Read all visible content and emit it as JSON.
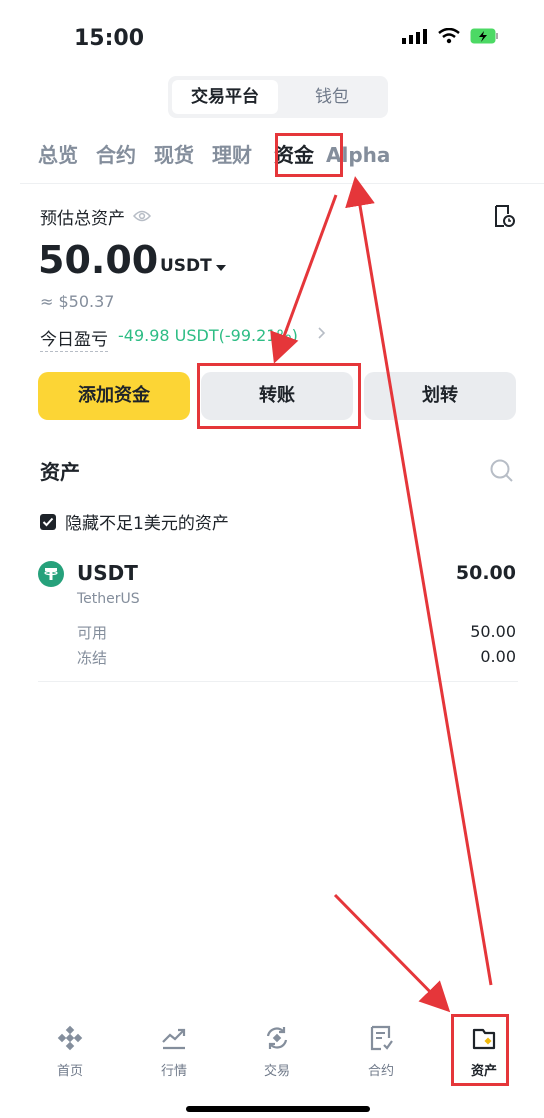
{
  "status_bar": {
    "time": "15:00"
  },
  "segmented": {
    "active": "交易平台",
    "inactive": "钱包"
  },
  "tabs": [
    "总览",
    "合约",
    "现货",
    "理财",
    "资金",
    "Alpha"
  ],
  "estimate": {
    "label": "预估总资产",
    "amount": "50.00",
    "currency": "USDT",
    "usd_approx": "≈ $50.37",
    "pnl_label": "今日盈亏",
    "pnl_value": "-49.98 USDT(-99.21%)"
  },
  "buttons": {
    "add": "添加资金",
    "transfer": "转账",
    "move": "划转"
  },
  "assets": {
    "title": "资产",
    "hide_small": "隐藏不足1美元的资产",
    "items": [
      {
        "symbol": "USDT",
        "name": "TetherUS",
        "total": "50.00",
        "available_label": "可用",
        "available": "50.00",
        "frozen_label": "冻结",
        "frozen": "0.00"
      }
    ]
  },
  "bottom_nav": [
    {
      "label": "首页",
      "icon": "home-icon"
    },
    {
      "label": "行情",
      "icon": "markets-icon"
    },
    {
      "label": "交易",
      "icon": "trade-icon"
    },
    {
      "label": "合约",
      "icon": "futures-icon"
    },
    {
      "label": "资产",
      "icon": "wallet-icon"
    }
  ],
  "colors": {
    "accent": "#fcd535",
    "profit": "#2ebd85",
    "annotation": "#e5363a"
  }
}
